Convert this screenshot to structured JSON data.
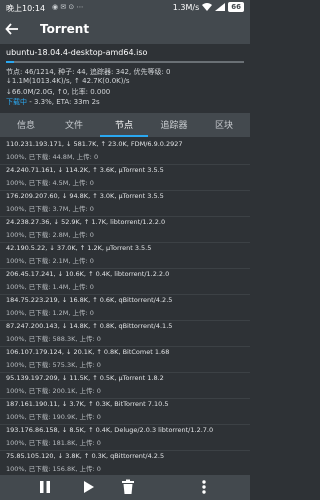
{
  "status_bar": {
    "time": "晚上10:14",
    "speed": "1.3M/s",
    "battery": "66"
  },
  "app_bar": {
    "title": "Torrent"
  },
  "torrent": {
    "name": "ubuntu-18.04.4-desktop-amd64.iso",
    "progress": 0.033,
    "line1": "节点: 46/1214, 种子: 44, 追踪器: 342, 优先等级: 0",
    "line2": "↓1.1M(1013.4K)/s, ↑ 42.7K(0.0K)/s",
    "line3": "↓66.0M/2.0G, ↑0, 比率: 0.000",
    "status_word": "下载中",
    "status_rest": " - 3.3%, ETA: 33m 2s"
  },
  "tabs": [
    {
      "label": "信息"
    },
    {
      "label": "文件"
    },
    {
      "label": "节点"
    },
    {
      "label": "追踪器"
    },
    {
      "label": "区块"
    }
  ],
  "active_tab": 2,
  "peers": [
    {
      "l1": "110.231.193.171, ↓ 581.7K, ↑ 23.0K, FDM/6.9.0.2927",
      "l2": "100%, 已下载: 44.8M, 上传: 0"
    },
    {
      "l1": "24.240.71.161, ↓ 114.2K, ↑ 3.6K, μTorrent 3.5.5",
      "l2": "100%, 已下载: 4.5M, 上传: 0"
    },
    {
      "l1": "176.209.207.60, ↓ 94.8K, ↑ 3.0K, μTorrent 3.5.5",
      "l2": "100%, 已下载: 3.7M, 上传: 0"
    },
    {
      "l1": "24.238.27.36, ↓ 52.9K, ↑ 1.7K, libtorrent/1.2.2.0",
      "l2": "100%, 已下载: 2.8M, 上传: 0"
    },
    {
      "l1": "42.190.5.22, ↓ 37.0K, ↑ 1.2K, μTorrent 3.5.5",
      "l2": "100%, 已下载: 2.1M, 上传: 0"
    },
    {
      "l1": "206.45.17.241, ↓ 10.6K, ↑ 0.4K, libtorrent/1.2.2.0",
      "l2": "100%, 已下载: 1.4M, 上传: 0"
    },
    {
      "l1": "184.75.223.219, ↓ 16.8K, ↑ 0.6K, qBittorrent/4.2.5",
      "l2": "100%, 已下载: 1.2M, 上传: 0"
    },
    {
      "l1": "87.247.200.143, ↓ 14.8K, ↑ 0.8K, qBittorrent/4.1.5",
      "l2": "100%, 已下载: 588.3K, 上传: 0"
    },
    {
      "l1": "106.107.179.124, ↓ 20.1K, ↑ 0.8K, BitComet 1.68",
      "l2": "100%, 已下载: 575.3K, 上传: 0"
    },
    {
      "l1": "95.139.197.209, ↓ 11.5K, ↑ 0.5K, μTorrent 1.8.2",
      "l2": "100%, 已下载: 200.1K, 上传: 0"
    },
    {
      "l1": "187.161.190.11, ↓ 3.7K, ↑ 0.3K, BitTorrent 7.10.5",
      "l2": "100%, 已下载: 190.9K, 上传: 0"
    },
    {
      "l1": "193.176.86.158, ↓ 8.5K, ↑ 0.4K, Deluge/2.0.3 libtorrent/1.2.7.0",
      "l2": "100%, 已下载: 181.8K, 上传: 0"
    },
    {
      "l1": "75.85.105.120, ↓ 3.8K, ↑ 0.3K, qBittorrent/4.2.5",
      "l2": "100%, 已下载: 156.8K, 上传: 0"
    }
  ],
  "bottom_bar": {
    "icons": [
      "pause-icon",
      "play-icon",
      "delete-icon",
      "more-icon"
    ]
  },
  "colors": {
    "accent": "#2aa8f0",
    "bar": "#43494e",
    "background": "#2e3236"
  }
}
